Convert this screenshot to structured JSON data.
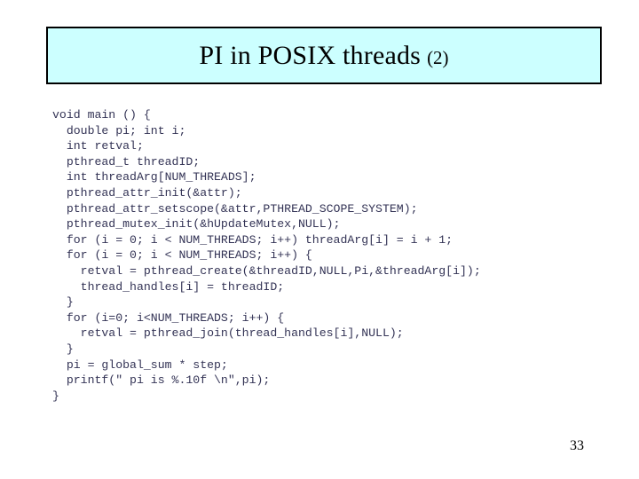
{
  "slide": {
    "title": {
      "main": "PI in POSIX threads",
      "suffix": "(2)",
      "background_color": "#ccffff",
      "border_color": "#000000"
    },
    "page_number": "33",
    "code": {
      "text_color": "#333355",
      "lines": [
        "void main () {",
        "  double pi; int i;",
        "  int retval;",
        "  pthread_t threadID;",
        "  int threadArg[NUM_THREADS];",
        "  pthread_attr_init(&attr);",
        "  pthread_attr_setscope(&attr,PTHREAD_SCOPE_SYSTEM);",
        "  pthread_mutex_init(&hUpdateMutex,NULL);",
        "  for (i = 0; i < NUM_THREADS; i++) threadArg[i] = i + 1;",
        "  for (i = 0; i < NUM_THREADS; i++) {",
        "    retval = pthread_create(&threadID,NULL,Pi,&threadArg[i]);",
        "    thread_handles[i] = threadID;",
        "  }",
        "  for (i=0; i<NUM_THREADS; i++) {",
        "    retval = pthread_join(thread_handles[i],NULL);",
        "  }",
        "  pi = global_sum * step;",
        "  printf(\" pi is %.10f \\n\",pi);",
        "}"
      ]
    }
  }
}
